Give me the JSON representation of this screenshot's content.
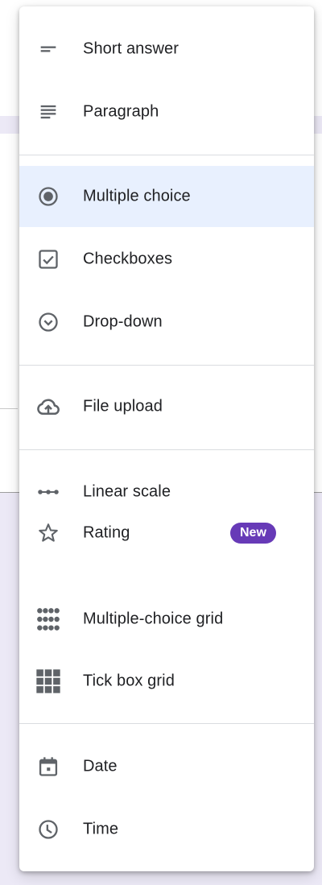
{
  "menu": {
    "items": [
      {
        "label": "Short answer",
        "icon": "short-answer-icon"
      },
      {
        "label": "Paragraph",
        "icon": "paragraph-icon"
      },
      {
        "label": "Multiple choice",
        "icon": "radio-button-icon",
        "selected": true
      },
      {
        "label": "Checkboxes",
        "icon": "checkbox-icon"
      },
      {
        "label": "Drop-down",
        "icon": "dropdown-circle-icon"
      },
      {
        "label": "File upload",
        "icon": "cloud-upload-icon"
      },
      {
        "label": "Linear scale",
        "icon": "linear-scale-icon"
      },
      {
        "label": "Rating",
        "icon": "star-icon",
        "badge": "New"
      },
      {
        "label": "Multiple-choice grid",
        "icon": "dot-grid-icon"
      },
      {
        "label": "Tick box grid",
        "icon": "square-grid-icon"
      },
      {
        "label": "Date",
        "icon": "calendar-icon"
      },
      {
        "label": "Time",
        "icon": "clock-icon"
      }
    ]
  },
  "colors": {
    "icon": "#5f6368",
    "label": "#202124",
    "selected_bg": "#e8f0fe",
    "badge_bg": "#673ab7",
    "divider": "#dadce0",
    "background_band": "#ece9f6"
  }
}
